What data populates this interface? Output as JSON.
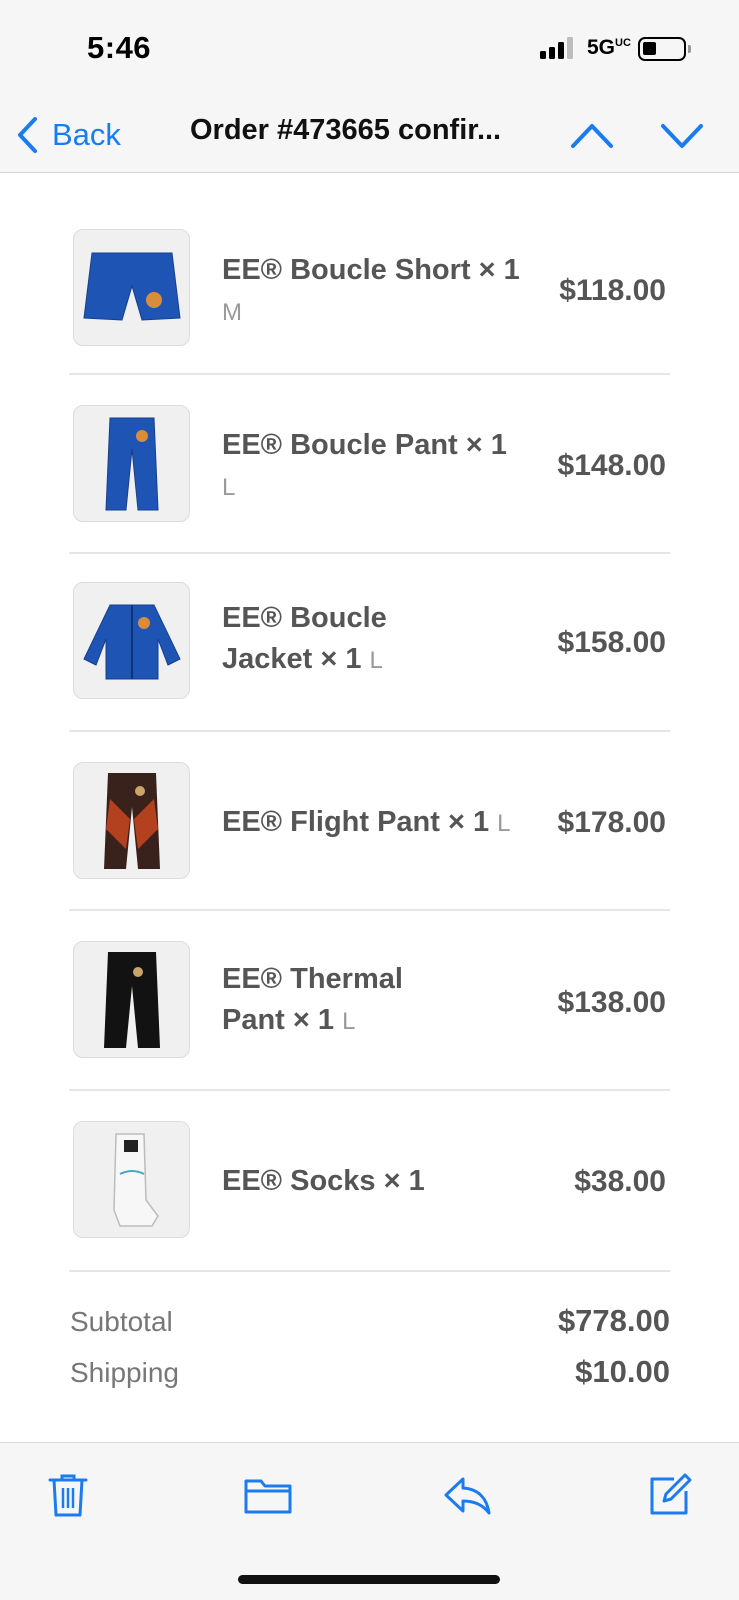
{
  "status_bar": {
    "time": "5:46",
    "network": "5G",
    "network_sup": "UC"
  },
  "nav": {
    "back_label": "Back",
    "title": "Order #473665 confir..."
  },
  "items": [
    {
      "name": "EE® Boucle Short × 1",
      "variant": "M",
      "price": "$118.00",
      "image": "blue-shorts"
    },
    {
      "name": "EE® Boucle Pant × 1",
      "variant": "L",
      "price": "$148.00",
      "image": "blue-pants"
    },
    {
      "name_line1": "EE® Boucle",
      "name_line2": "Jacket × 1",
      "variant": "L",
      "price": "$158.00",
      "image": "blue-jacket"
    },
    {
      "name": "EE® Flight Pant × 1",
      "variant": "L",
      "price": "$178.00",
      "image": "brown-flight-pants"
    },
    {
      "name_line1": "EE® Thermal",
      "name_line2": "Pant × 1",
      "variant": "L",
      "price": "$138.00",
      "image": "black-thermal-pants"
    },
    {
      "name": "EE® Socks × 1",
      "variant": "",
      "price": "$38.00",
      "image": "white-socks"
    }
  ],
  "summary": {
    "subtotal_label": "Subtotal",
    "subtotal_value": "$778.00",
    "shipping_label": "Shipping",
    "shipping_value": "$10.00"
  },
  "toolbar": {
    "icons": [
      "trash-icon",
      "folder-icon",
      "reply-icon",
      "compose-icon"
    ]
  },
  "colors": {
    "accent": "#1a7cf0",
    "bar_bg": "#f6f6f7",
    "text": "#555555"
  }
}
